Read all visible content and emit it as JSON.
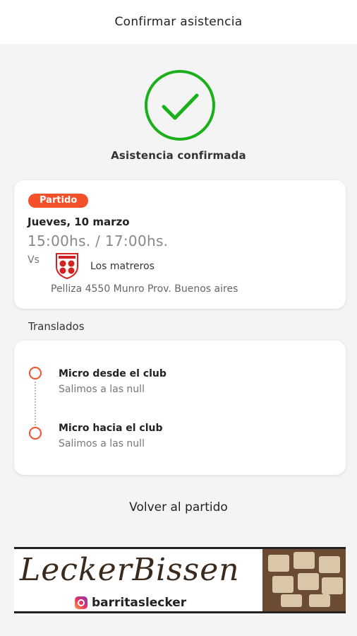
{
  "header": {
    "title": "Confirmar asistencia"
  },
  "status": {
    "message": "Asistencia confirmada",
    "color": "#1bb01b"
  },
  "match": {
    "badge": "Partido",
    "badge_color": "#f4502a",
    "date": "Jueves, 10 marzo",
    "time": "15:00hs. / 17:00hs.",
    "vs_label": "Vs",
    "team": "Los matreros",
    "crest_icon": "club-crest-icon",
    "address": "Pelliza 4550 Munro Prov. Buenos aires"
  },
  "transfers": {
    "title": "Translados",
    "items": [
      {
        "title": "Micro desde el club",
        "subtitle": "Salimos a las null"
      },
      {
        "title": "Micro hacia el club",
        "subtitle": "Salimos a las  null"
      }
    ]
  },
  "back_label": "Volver al partido",
  "banner": {
    "brand": "LeckerBissen",
    "instagram_handle": "barritaslecker",
    "icon": "instagram-icon"
  }
}
